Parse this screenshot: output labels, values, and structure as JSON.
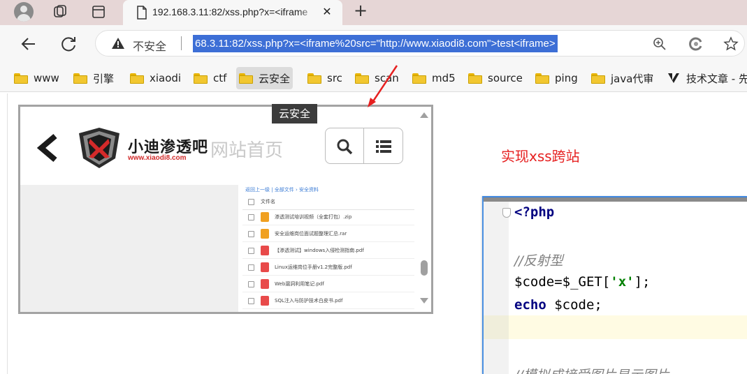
{
  "browser": {
    "tab_title": "192.168.3.11:82/xss.php?x=<iframe",
    "tab_close": "✕",
    "new_tab": "+",
    "security_label": "不安全",
    "url": "68.3.11:82/xss.php?x=<iframe%20src=\"http://www.xiaodi8.com\">test<iframe>"
  },
  "bookmarks": [
    {
      "label": "www"
    },
    {
      "label": "引擎"
    },
    {
      "label": "xiaodi"
    },
    {
      "label": "ctf"
    },
    {
      "label": "云安全"
    },
    {
      "label": "src"
    },
    {
      "label": "scan"
    },
    {
      "label": "md5"
    },
    {
      "label": "source"
    },
    {
      "label": "ping"
    },
    {
      "label": "java代审"
    },
    {
      "label": "技术文章 - 先"
    }
  ],
  "tooltip": "云安全",
  "annotation": "实现xss跨站",
  "iframe": {
    "brand_name": "小迪渗透吧",
    "brand_url": "www.xiaodi8.com",
    "home_title": "网站首页",
    "breadcrumb": "返回上一级 | 全部文件 › 安全资料",
    "column_header": "文件名",
    "files": [
      {
        "name": "渗透测试培训视频（全套打包）.zip",
        "color": "#f0a020"
      },
      {
        "name": "安全运维岗位面试题整理汇总.rar",
        "color": "#f0a020"
      },
      {
        "name": "【渗透测试】windows入侵检测指南.pdf",
        "color": "#e84a4a"
      },
      {
        "name": "Linux运维岗位手册v1.2完整版.pdf",
        "color": "#e84a4a"
      },
      {
        "name": "Web漏洞利用笔记.pdf",
        "color": "#e84a4a"
      },
      {
        "name": "SQL注入与防护技术白皮书.pdf",
        "color": "#e84a4a"
      }
    ]
  },
  "code": {
    "line1": "<?php",
    "line2": "//反射型",
    "line3_a": "$code=$_GET[",
    "line3_str": "'x'",
    "line3_b": "];",
    "line4_kw": "echo",
    "line4_b": " $code;",
    "line5": "//模拟成接受图片显示图片"
  },
  "colors": {
    "url_highlight": "#3d6fd6",
    "annotation": "#e62020",
    "tab_strip": "#e6d6d6"
  }
}
